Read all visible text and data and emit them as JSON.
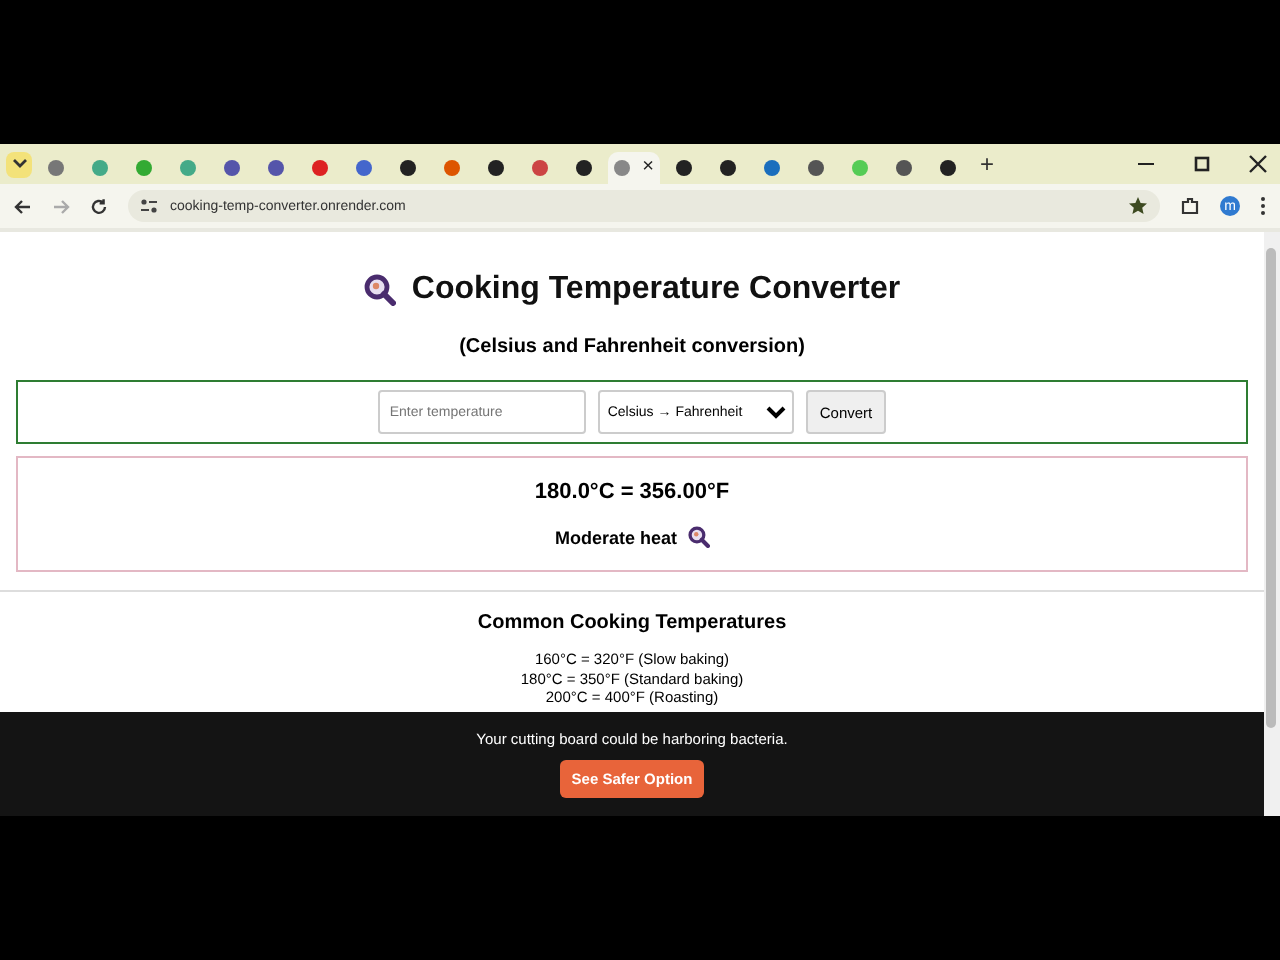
{
  "browser": {
    "tabs": [
      {
        "selected": false
      },
      {
        "selected": false
      },
      {
        "selected": false
      },
      {
        "selected": false
      },
      {
        "selected": false
      },
      {
        "selected": false
      },
      {
        "selected": false
      },
      {
        "selected": false
      },
      {
        "selected": false
      },
      {
        "selected": false
      },
      {
        "selected": false
      },
      {
        "selected": false
      },
      {
        "selected": false
      },
      {
        "selected": true
      },
      {
        "selected": false
      },
      {
        "selected": false
      },
      {
        "selected": false
      },
      {
        "selected": false
      },
      {
        "selected": false
      },
      {
        "selected": false
      },
      {
        "selected": false
      }
    ],
    "new_tab": "+",
    "close_tab": "×",
    "address": "cooking-temp-converter.onrender.com",
    "profile": "m"
  },
  "page": {
    "title": "Cooking Temperature Converter",
    "subtitle": "(Celsius and Fahrenheit conversion)",
    "form": {
      "placeholder": "Enter temperature",
      "direction": "Celsius → Fahrenheit",
      "button": "Convert"
    },
    "result": {
      "value": "180.0°C = 356.00°F",
      "label": "Moderate heat"
    },
    "reference": {
      "heading": "Common Cooking Temperatures",
      "items": [
        "160°C = 320°F (Slow baking)",
        "180°C = 350°F (Standard baking)",
        "200°C = 400°F (Roasting)"
      ]
    },
    "banner": {
      "message": "Your cutting board could be harboring bacteria.",
      "button": "See Safer Option"
    }
  }
}
